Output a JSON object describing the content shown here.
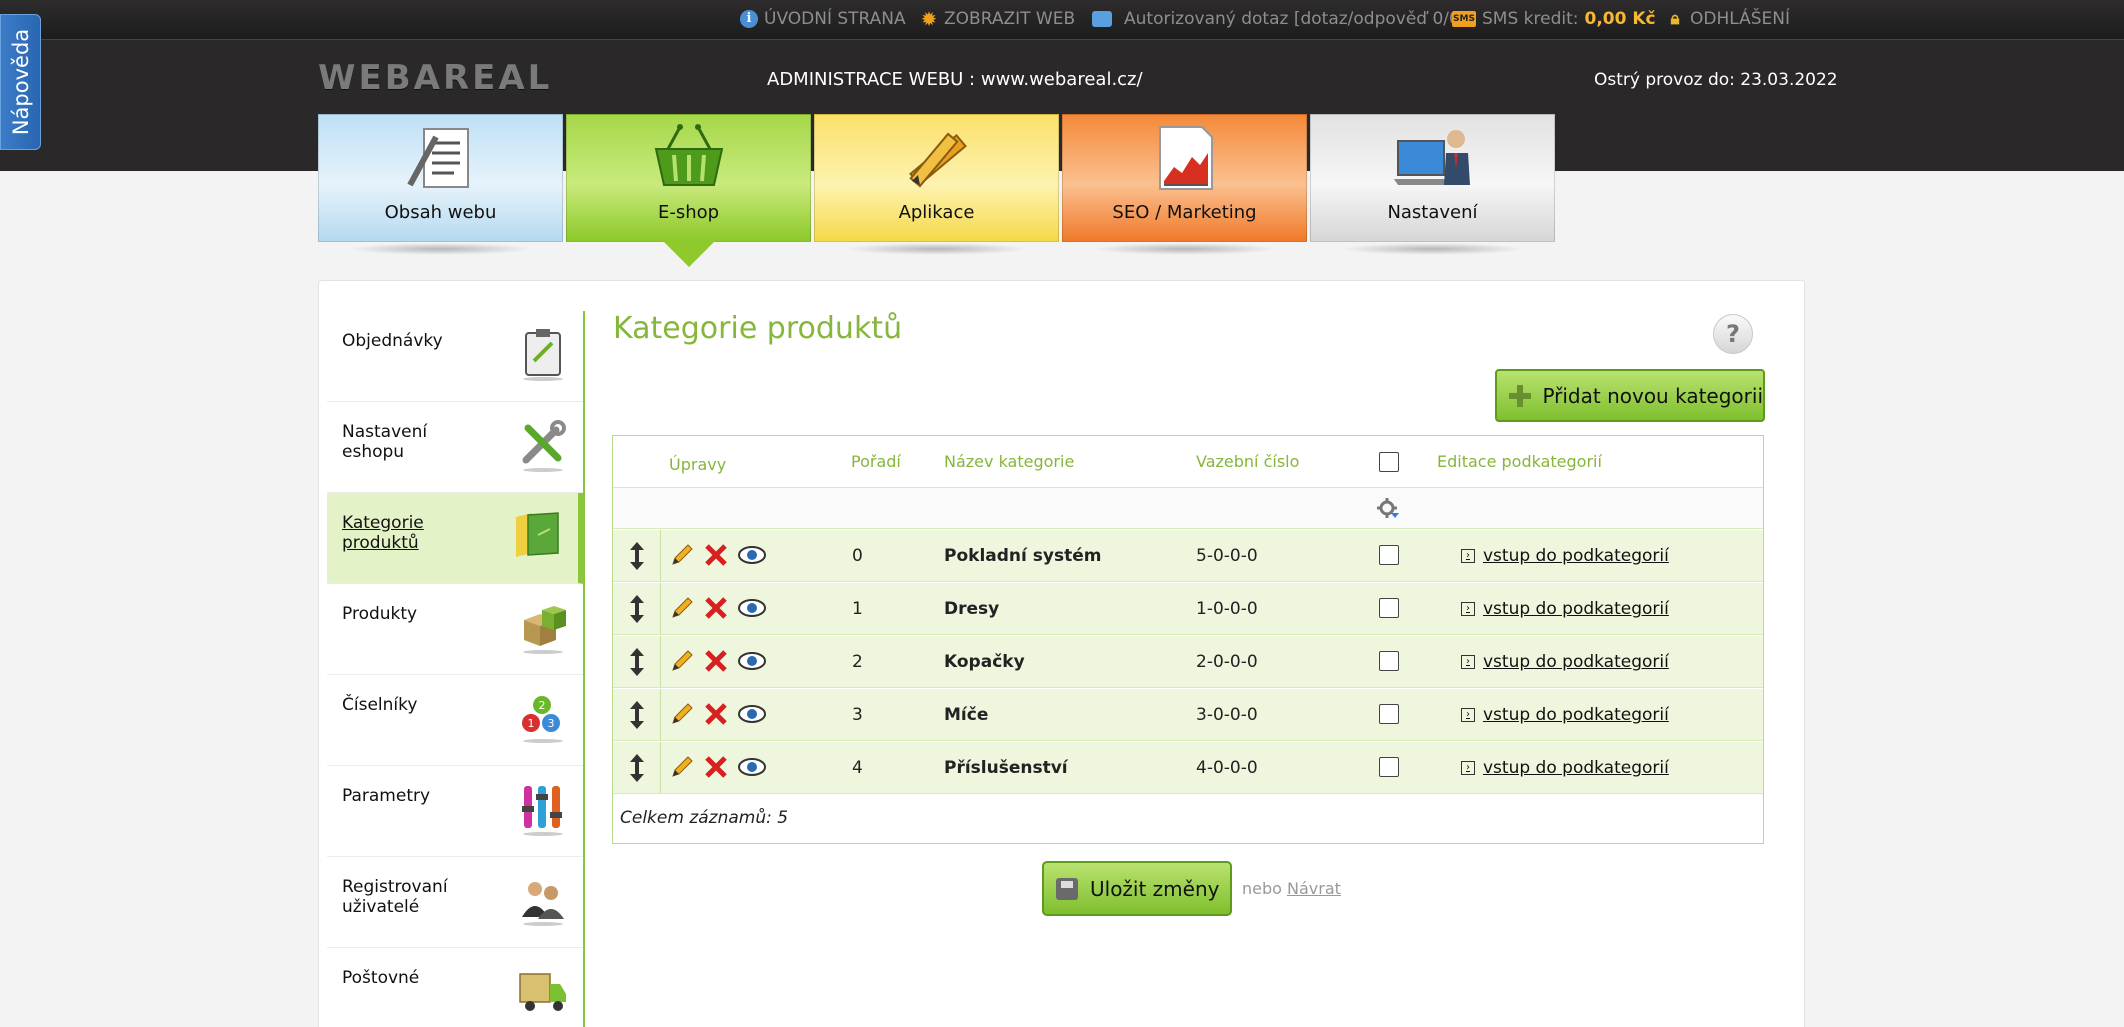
{
  "topbar": {
    "home": "ÚVODNÍ STRANA",
    "show_web": "ZOBRAZIT WEB",
    "query": "Autorizovaný dotaz [dotaz/odpověď 0/0]",
    "sms_label": "SMS kredit:",
    "sms_value": "0,00 Kč",
    "logout": "ODHLÁŠENÍ"
  },
  "help_tab": "Nápověda",
  "header": {
    "logo": "WEBAREAL",
    "admin_title": "ADMINISTRACE WEBU : www.webareal.cz/",
    "deadline": "Ostrý provoz do: 23.03.2022"
  },
  "nav": {
    "tiles": [
      {
        "label": "Obsah webu",
        "icon": "document-icon"
      },
      {
        "label": "E-shop",
        "icon": "basket-icon"
      },
      {
        "label": "Aplikace",
        "icon": "tools-icon"
      },
      {
        "label": "SEO / Marketing",
        "icon": "chart-icon"
      },
      {
        "label": "Nastavení",
        "icon": "laptop-icon"
      }
    ],
    "active": "E-shop"
  },
  "sidebar": {
    "items": [
      {
        "label": "Objednávky",
        "icon": "clipboard-icon"
      },
      {
        "label": "Nastavení eshopu",
        "icon": "wrench-icon"
      },
      {
        "label": "Kategorie produktů",
        "icon": "folder-icon",
        "active": true
      },
      {
        "label": "Produkty",
        "icon": "boxes-icon"
      },
      {
        "label": "Číselníky",
        "icon": "numbers-icon"
      },
      {
        "label": "Parametry",
        "icon": "sliders-icon"
      },
      {
        "label": "Registrovaní uživatelé",
        "icon": "users-icon"
      },
      {
        "label": "Poštovné",
        "icon": "truck-icon"
      }
    ]
  },
  "main": {
    "title": "Kategorie produktů",
    "add_button": "Přidat novou kategorii",
    "table": {
      "headers": {
        "edits": "Úpravy",
        "order": "Pořadí",
        "name": "Název kategorie",
        "code": "Vazební číslo",
        "subcategories": "Editace podkategorií"
      },
      "rows": [
        {
          "order": "0",
          "name": "Pokladní systém",
          "code": "5-0-0-0",
          "link": "vstup do podkategorií"
        },
        {
          "order": "1",
          "name": "Dresy",
          "code": "1-0-0-0",
          "link": "vstup do podkategorií"
        },
        {
          "order": "2",
          "name": "Kopačky",
          "code": "2-0-0-0",
          "link": "vstup do podkategorií"
        },
        {
          "order": "3",
          "name": "Míče",
          "code": "3-0-0-0",
          "link": "vstup do podkategorií"
        },
        {
          "order": "4",
          "name": "Příslušenství",
          "code": "4-0-0-0",
          "link": "vstup do podkategorií"
        }
      ],
      "total": "Celkem záznamů: 5"
    },
    "save_button": "Uložit změny",
    "or_text": "nebo",
    "back_link": "Návrat"
  }
}
